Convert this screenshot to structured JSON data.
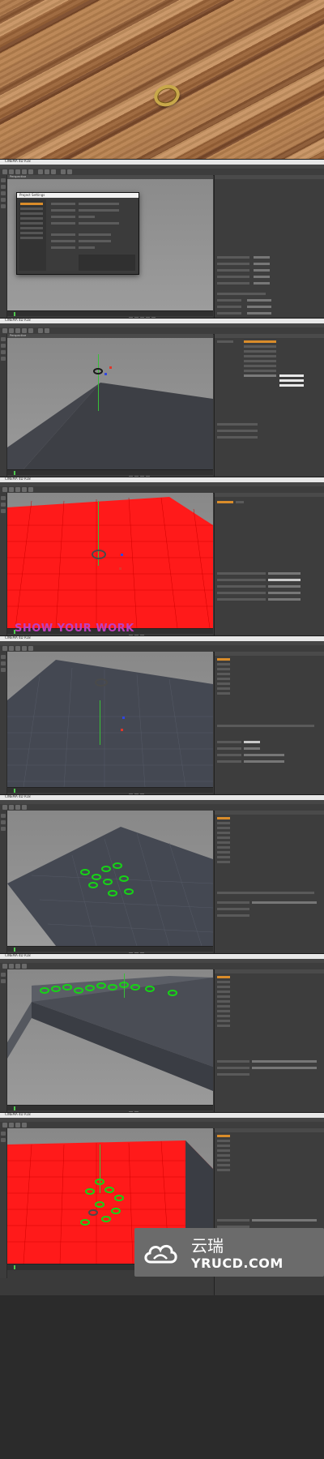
{
  "hero": {
    "subject": "gold-ring-on-wood"
  },
  "panels": [
    {
      "index": 1,
      "window_title": "CINEMA 4D R18",
      "viewport_label": "Perspective",
      "dialog_title": "Project Settings",
      "materials": [
        "Create",
        "Edit",
        "Function",
        "Texture"
      ]
    },
    {
      "index": 2,
      "window_title": "CINEMA 4D R18",
      "viewport_label": "Perspective",
      "materials": [
        "Create",
        "Edit",
        "Function",
        "Texture"
      ]
    },
    {
      "index": 3,
      "window_title": "CINEMA 4D R18",
      "viewport_label": "Perspective",
      "materials": [
        "Create",
        "Edit",
        "Function",
        "Texture"
      ]
    },
    {
      "index": 4,
      "window_title": "CINEMA 4D R18",
      "viewport_label": "Perspective",
      "materials": [
        "Create",
        "Edit",
        "Function",
        "Texture"
      ]
    },
    {
      "index": 5,
      "window_title": "CINEMA 4D R18",
      "viewport_label": "Perspective",
      "materials": [
        "Create",
        "Edit",
        "Function",
        "Texture"
      ]
    },
    {
      "index": 6,
      "window_title": "CINEMA 4D R18",
      "viewport_label": "Perspective",
      "materials": [
        "Create",
        "Edit",
        "Function",
        "Texture"
      ]
    },
    {
      "index": 7,
      "window_title": "CINEMA 4D R18",
      "viewport_label": "Perspective",
      "materials": [
        "Create",
        "Edit",
        "Function",
        "Texture"
      ]
    }
  ],
  "overlay": {
    "show_your_work": "SHOW YOUR WORK"
  },
  "watermark": {
    "cn": "云瑞",
    "en": "YRUCD.COM"
  },
  "colors": {
    "red_plane": "#ff1a1a",
    "green_torus": "#16d416",
    "overlay_text": "#c03fc0",
    "ui_bg": "#3a3a3a"
  }
}
